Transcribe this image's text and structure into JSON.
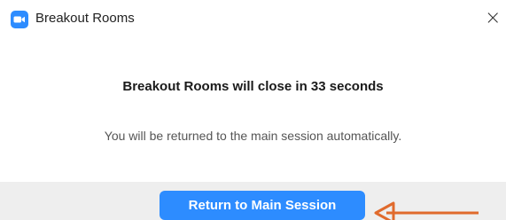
{
  "window": {
    "title": "Breakout Rooms",
    "close_symbol": "×",
    "icon": "zoom-camera-icon"
  },
  "message": {
    "headline": "Breakout Rooms will close in 33 seconds",
    "subtext": "You will be returned to the main session automatically."
  },
  "actions": {
    "return_label": "Return to Main Session"
  },
  "annotation": {
    "icon": "arrow-left-icon",
    "color": "#E06A2C"
  },
  "colors": {
    "accent": "#2D8CFF",
    "footer": "#EEEEEE"
  }
}
